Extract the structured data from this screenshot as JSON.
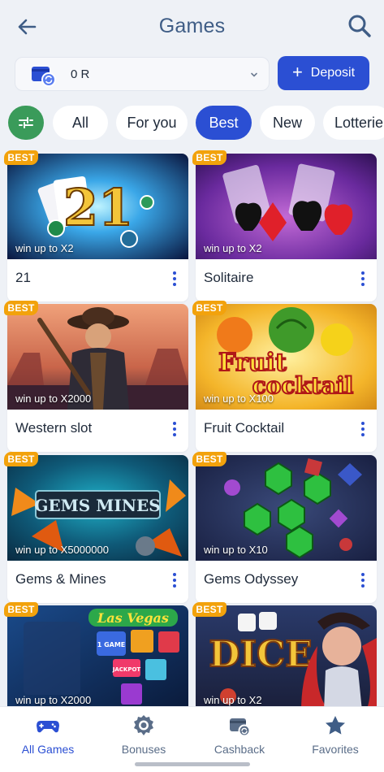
{
  "header": {
    "title": "Games",
    "back_icon": "arrow-left-icon",
    "search_icon": "search-icon"
  },
  "wallet": {
    "value": "0 R",
    "icon": "wallet-sync-icon"
  },
  "deposit": {
    "label": "Deposit"
  },
  "filters": [
    {
      "label": "All",
      "active": false
    },
    {
      "label": "For you",
      "active": false
    },
    {
      "label": "Best",
      "active": true
    },
    {
      "label": "New",
      "active": false
    },
    {
      "label": "Lotterie",
      "active": false
    }
  ],
  "badge_label": "BEST",
  "games": [
    {
      "name": "21",
      "win": "win up to X2"
    },
    {
      "name": "Solitaire",
      "win": "win up to X2"
    },
    {
      "name": "Western slot",
      "win": "win up to X2000"
    },
    {
      "name": "Fruit Cocktail",
      "win": "win up to X100"
    },
    {
      "name": "Gems & Mines",
      "win": "win up to X5000000"
    },
    {
      "name": "Gems Odyssey",
      "win": "win up to X10"
    },
    {
      "name": "",
      "win": "win up to X2000"
    },
    {
      "name": "",
      "win": "win up to X2"
    }
  ],
  "art_text": {
    "gems_mines": "GEMS MINES",
    "fruit": "Fruit",
    "cocktail": "cocktail",
    "las_vegas": "Las Vegas",
    "dice": "DICE",
    "game_chip": "1 GAME",
    "jackpot": "JACKPOT"
  },
  "nav": [
    {
      "label": "All Games",
      "icon": "gamepad-icon",
      "active": true
    },
    {
      "label": "Bonuses",
      "icon": "bonus-icon",
      "active": false
    },
    {
      "label": "Cashback",
      "icon": "cashback-icon",
      "active": false
    },
    {
      "label": "Favorites",
      "icon": "star-icon",
      "active": false
    }
  ],
  "colors": {
    "accent": "#2b4fd3",
    "title": "#3f5d86",
    "badge": "#f2a20c",
    "filter": "#3a9b5a"
  }
}
